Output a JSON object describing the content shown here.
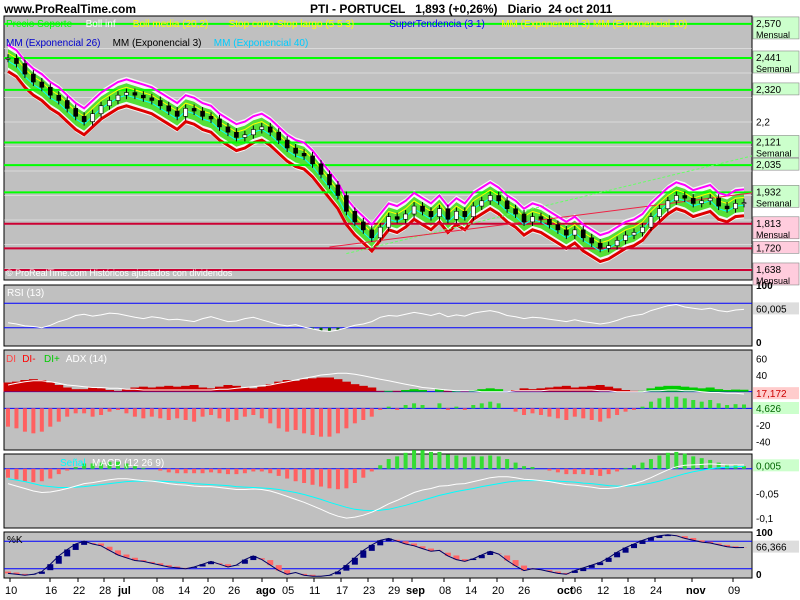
{
  "site": "www.ProRealTime.com",
  "header": {
    "symbol": "PTI - PORTUCEL",
    "price": "1,893",
    "change": "(+0,26%)",
    "timeframe": "Diario",
    "date": "24 oct 2011"
  },
  "colors": {
    "panel_bg": "#c0c0c0",
    "grid": "#ffffff",
    "green_level": "#00ff00",
    "red_level": "#cc0033",
    "rsi_line": "#ffffff",
    "adx_line": "#ffffff",
    "macd_line": "#ffffff",
    "signal_line": "#00ffff",
    "hist_pos": "#33dd33",
    "hist_neg": "#ff6060"
  },
  "chart_data": [
    {
      "type": "line",
      "panel": "price",
      "legend_row1": [
        "Precio Soporte",
        "Boll inf",
        "Boll media (20,2)",
        "Stop corto Stop largo (5 5 3)",
        "SuperTendencia (3 1)",
        "MM (Exponencial 3) MM (Exponencial 10)"
      ],
      "legend_row2": [
        "MM (Exponencial 26)",
        "MM (Exponencial 3)",
        "MM (Exponencial 40)"
      ],
      "watermark": "© ProRealTime.com  Históricos ajustados con dividendos",
      "ylim": [
        1.6,
        2.6
      ],
      "y_ticks": [
        "2,2"
      ],
      "level_boxes": [
        {
          "value": "2,570",
          "sub": "Mensual",
          "y": 2.57,
          "color": "green"
        },
        {
          "value": "2,441",
          "sub": "Semanal",
          "y": 2.441,
          "color": "green"
        },
        {
          "value": "2,320",
          "sub": "",
          "y": 2.32,
          "color": "green"
        },
        {
          "value": "2,121",
          "sub": "Semanal",
          "y": 2.121,
          "color": "green"
        },
        {
          "value": "2,035",
          "sub": "",
          "y": 2.035,
          "color": "green"
        },
        {
          "value": "1,932",
          "sub": "Semanal",
          "y": 1.932,
          "color": "green"
        },
        {
          "value": "1,813",
          "sub": "Mensual",
          "y": 1.813,
          "color": "red"
        },
        {
          "value": "1,720",
          "sub": "",
          "y": 1.72,
          "color": "red"
        },
        {
          "value": "1,638",
          "sub": "Mensual",
          "y": 1.638,
          "color": "red"
        }
      ],
      "price_close": [
        2.44,
        2.42,
        2.38,
        2.35,
        2.33,
        2.3,
        2.28,
        2.25,
        2.22,
        2.2,
        2.23,
        2.26,
        2.28,
        2.3,
        2.31,
        2.3,
        2.29,
        2.28,
        2.26,
        2.24,
        2.22,
        2.25,
        2.24,
        2.22,
        2.21,
        2.18,
        2.16,
        2.14,
        2.15,
        2.17,
        2.18,
        2.16,
        2.13,
        2.1,
        2.08,
        2.07,
        2.04,
        2.0,
        1.96,
        1.92,
        1.86,
        1.82,
        1.79,
        1.76,
        1.8,
        1.84,
        1.83,
        1.85,
        1.88,
        1.86,
        1.84,
        1.87,
        1.83,
        1.86,
        1.84,
        1.88,
        1.9,
        1.92,
        1.9,
        1.87,
        1.85,
        1.82,
        1.84,
        1.83,
        1.81,
        1.79,
        1.77,
        1.79,
        1.76,
        1.74,
        1.72,
        1.73,
        1.75,
        1.77,
        1.78,
        1.8,
        1.84,
        1.87,
        1.9,
        1.92,
        1.91,
        1.89,
        1.9,
        1.91,
        1.88,
        1.87,
        1.89,
        1.893
      ]
    },
    {
      "type": "line",
      "panel": "rsi",
      "title": "RSI (13)",
      "ylim": [
        0,
        100
      ],
      "y_ticks": [
        "100",
        "0"
      ],
      "value_label": "60,005",
      "values": [
        38,
        36,
        33,
        32,
        30,
        34,
        40,
        44,
        50,
        52,
        49,
        51,
        54,
        53,
        50,
        47,
        45,
        48,
        46,
        43,
        44,
        42,
        40,
        45,
        48,
        44,
        40,
        41,
        45,
        47,
        43,
        39,
        35,
        33,
        35,
        31,
        28,
        25,
        24,
        26,
        30,
        34,
        36,
        40,
        47,
        50,
        49,
        52,
        55,
        53,
        50,
        54,
        48,
        51,
        49,
        54,
        56,
        58,
        55,
        50,
        48,
        45,
        47,
        46,
        44,
        42,
        40,
        43,
        40,
        38,
        36,
        38,
        42,
        47,
        50,
        52,
        58,
        62,
        66,
        68,
        64,
        62,
        60,
        62,
        58,
        56,
        59,
        60
      ]
    },
    {
      "type": "area",
      "panel": "adx",
      "legend": [
        "DI",
        "DI-",
        "DI+",
        "ADX (14)"
      ],
      "ylim": [
        -50,
        70
      ],
      "y_ticks": [
        "60",
        "40",
        "20",
        "0",
        "-20",
        "-40"
      ],
      "value_labels": [
        "17,172",
        "4,626"
      ],
      "adx": [
        28,
        30,
        32,
        33,
        33,
        32,
        30,
        28,
        27,
        26,
        25,
        25,
        24,
        24,
        23,
        23,
        22,
        22,
        22,
        22,
        22,
        22,
        22,
        22,
        22,
        23,
        23,
        24,
        25,
        26,
        27,
        28,
        30,
        32,
        34,
        36,
        38,
        40,
        41,
        42,
        42,
        41,
        39,
        37,
        35,
        33,
        31,
        29,
        27,
        25,
        24,
        23,
        22,
        21,
        21,
        21,
        20,
        20,
        20,
        20,
        21,
        21,
        21,
        21,
        22,
        22,
        22,
        22,
        22,
        22,
        21,
        21,
        20,
        20,
        20,
        20,
        21,
        21,
        22,
        22,
        21,
        21,
        20,
        19,
        19,
        18,
        18,
        17.172
      ],
      "di_diff": [
        -22,
        -24,
        -28,
        -30,
        -28,
        -22,
        -16,
        -10,
        -6,
        -6,
        -10,
        -8,
        -4,
        -2,
        -6,
        -10,
        -12,
        -10,
        -12,
        -14,
        -12,
        -14,
        -16,
        -10,
        -8,
        -12,
        -16,
        -14,
        -10,
        -8,
        -12,
        -18,
        -24,
        -28,
        -26,
        -30,
        -32,
        -34,
        -34,
        -30,
        -24,
        -18,
        -14,
        -10,
        -2,
        2,
        -2,
        4,
        6,
        4,
        0,
        6,
        -2,
        2,
        -2,
        4,
        6,
        8,
        6,
        0,
        -4,
        -8,
        -6,
        -8,
        -10,
        -12,
        -14,
        -10,
        -12,
        -14,
        -16,
        -12,
        -8,
        -4,
        -2,
        2,
        8,
        12,
        14,
        14,
        12,
        10,
        8,
        10,
        6,
        4,
        5,
        4.626
      ]
    },
    {
      "type": "bar",
      "panel": "macd",
      "title": "MACD (12 26 9)",
      "legend": [
        "Señal",
        "MACD (12 26 9)"
      ],
      "ylim": [
        -0.12,
        0.03
      ],
      "y_ticks": [
        "-0,05",
        "-0,1"
      ],
      "value_label": "0,005",
      "macd": [
        -0.03,
        -0.035,
        -0.04,
        -0.045,
        -0.048,
        -0.047,
        -0.044,
        -0.04,
        -0.035,
        -0.03,
        -0.028,
        -0.025,
        -0.022,
        -0.02,
        -0.02,
        -0.022,
        -0.024,
        -0.025,
        -0.027,
        -0.03,
        -0.032,
        -0.033,
        -0.035,
        -0.036,
        -0.036,
        -0.038,
        -0.04,
        -0.042,
        -0.042,
        -0.041,
        -0.042,
        -0.045,
        -0.05,
        -0.056,
        -0.062,
        -0.068,
        -0.075,
        -0.082,
        -0.09,
        -0.096,
        -0.1,
        -0.098,
        -0.094,
        -0.088,
        -0.08,
        -0.071,
        -0.064,
        -0.056,
        -0.048,
        -0.043,
        -0.04,
        -0.035,
        -0.034,
        -0.031,
        -0.03,
        -0.026,
        -0.022,
        -0.018,
        -0.016,
        -0.016,
        -0.018,
        -0.021,
        -0.022,
        -0.024,
        -0.026,
        -0.029,
        -0.032,
        -0.033,
        -0.035,
        -0.037,
        -0.04,
        -0.04,
        -0.038,
        -0.034,
        -0.03,
        -0.025,
        -0.018,
        -0.01,
        -0.002,
        0.004,
        0.007,
        0.008,
        0.009,
        0.01,
        0.009,
        0.008,
        0.008,
        0.008
      ],
      "signal": [
        -0.02,
        -0.023,
        -0.026,
        -0.03,
        -0.034,
        -0.036,
        -0.038,
        -0.038,
        -0.037,
        -0.036,
        -0.034,
        -0.032,
        -0.03,
        -0.028,
        -0.026,
        -0.025,
        -0.025,
        -0.025,
        -0.025,
        -0.026,
        -0.027,
        -0.028,
        -0.03,
        -0.031,
        -0.032,
        -0.033,
        -0.034,
        -0.036,
        -0.037,
        -0.038,
        -0.039,
        -0.04,
        -0.042,
        -0.045,
        -0.048,
        -0.052,
        -0.057,
        -0.062,
        -0.068,
        -0.073,
        -0.078,
        -0.082,
        -0.084,
        -0.085,
        -0.084,
        -0.082,
        -0.078,
        -0.074,
        -0.069,
        -0.064,
        -0.059,
        -0.054,
        -0.05,
        -0.046,
        -0.043,
        -0.04,
        -0.036,
        -0.033,
        -0.03,
        -0.027,
        -0.025,
        -0.024,
        -0.024,
        -0.024,
        -0.024,
        -0.025,
        -0.026,
        -0.027,
        -0.029,
        -0.03,
        -0.032,
        -0.034,
        -0.035,
        -0.035,
        -0.034,
        -0.032,
        -0.029,
        -0.025,
        -0.02,
        -0.015,
        -0.01,
        -0.006,
        -0.003,
        0.0,
        0.002,
        0.003,
        0.004,
        0.005
      ]
    },
    {
      "type": "area",
      "panel": "stochastic",
      "title": "%K",
      "ylim": [
        0,
        100
      ],
      "y_ticks": [
        "100",
        "0"
      ],
      "value_label": "66,366",
      "k": [
        10,
        8,
        6,
        8,
        14,
        30,
        48,
        62,
        74,
        80,
        74,
        70,
        60,
        50,
        44,
        38,
        36,
        32,
        28,
        24,
        22,
        20,
        24,
        30,
        36,
        30,
        24,
        28,
        40,
        48,
        40,
        28,
        16,
        8,
        12,
        6,
        4,
        4,
        6,
        14,
        28,
        44,
        60,
        72,
        82,
        86,
        80,
        74,
        70,
        64,
        58,
        60,
        48,
        40,
        36,
        42,
        50,
        58,
        52,
        38,
        26,
        16,
        20,
        18,
        14,
        10,
        8,
        16,
        22,
        28,
        34,
        44,
        56,
        66,
        74,
        82,
        88,
        92,
        94,
        92,
        86,
        82,
        78,
        76,
        72,
        68,
        66,
        66.366
      ],
      "d": [
        14,
        12,
        9,
        7,
        9,
        17,
        31,
        47,
        61,
        72,
        76,
        75,
        68,
        60,
        51,
        44,
        39,
        35,
        32,
        28,
        25,
        22,
        22,
        25,
        30,
        32,
        30,
        27,
        31,
        39,
        43,
        39,
        28,
        17,
        12,
        9,
        7,
        5,
        5,
        8,
        16,
        29,
        44,
        59,
        71,
        80,
        83,
        80,
        75,
        69,
        64,
        61,
        55,
        49,
        41,
        39,
        43,
        50,
        53,
        49,
        39,
        27,
        21,
        18,
        17,
        14,
        11,
        11,
        15,
        22,
        28,
        35,
        45,
        55,
        65,
        74,
        81,
        87,
        91,
        93,
        91,
        87,
        82,
        79,
        75,
        72,
        69,
        67
      ]
    }
  ],
  "x_axis": {
    "ticks": [
      "10",
      "16",
      "22",
      "28",
      "jul",
      "08",
      "14",
      "20",
      "26",
      "ago",
      "05",
      "11",
      "17",
      "23",
      "29",
      "sep",
      "08",
      "14",
      "20",
      "26",
      "oct",
      "06",
      "12",
      "18",
      "24",
      "nov",
      "09"
    ]
  }
}
